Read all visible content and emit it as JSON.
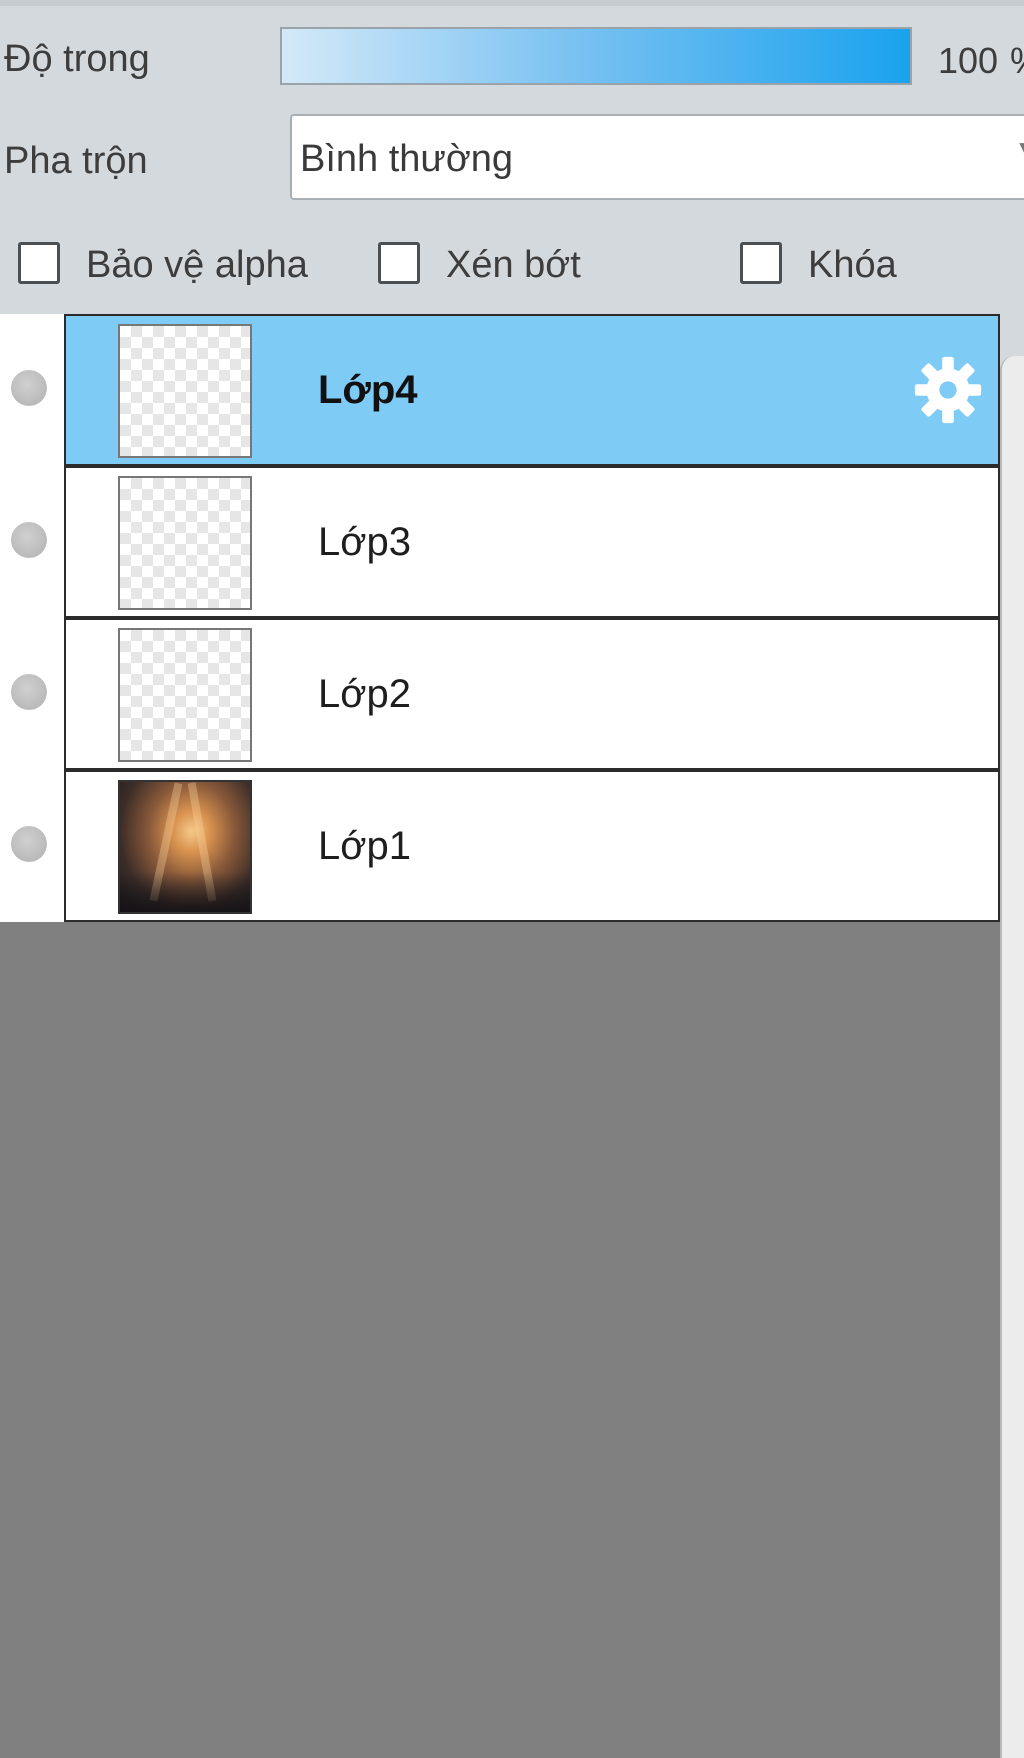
{
  "opacity": {
    "label": "Độ trong",
    "value": "100",
    "suffix": "%",
    "level_percent": 100
  },
  "blend": {
    "label": "Pha trộn",
    "value": "Bình thường",
    "arrow": "▼"
  },
  "options": {
    "protect_alpha": {
      "label": "Bảo vệ alpha",
      "checked": false
    },
    "clip": {
      "label": "Xén bớt",
      "checked": false
    },
    "lock": {
      "label": "Khóa",
      "checked": false
    }
  },
  "layers": [
    {
      "name": "Lớp4",
      "selected": true,
      "thumbnail": "transparent",
      "settings_icon": "gear-icon"
    },
    {
      "name": "Lớp3",
      "selected": false,
      "thumbnail": "transparent"
    },
    {
      "name": "Lớp2",
      "selected": false,
      "thumbnail": "transparent"
    },
    {
      "name": "Lớp1",
      "selected": false,
      "thumbnail": "photo"
    }
  ],
  "colors": {
    "selected_row": "#7ecbf5",
    "slider_fill_end": "#1aa2ee",
    "empty_area": "#808080",
    "panel_bg": "#d4d9dd"
  }
}
